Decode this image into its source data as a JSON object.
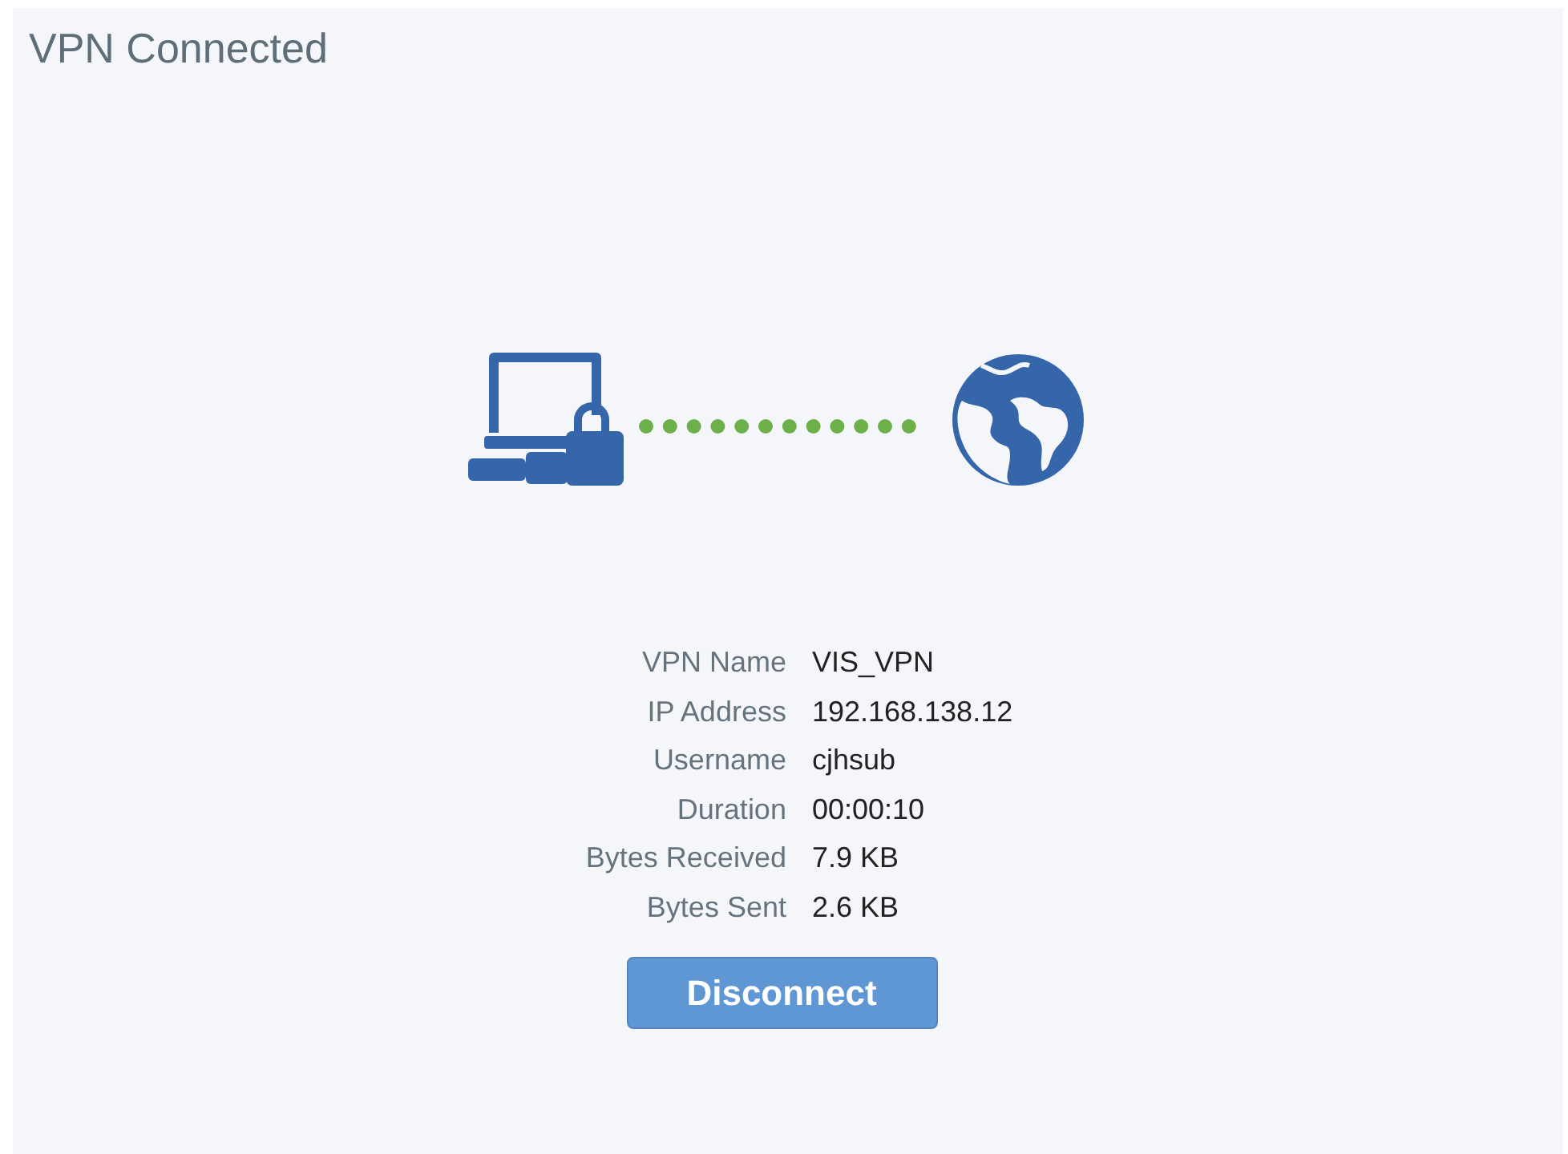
{
  "title": "VPN Connected",
  "details": [
    {
      "label": "VPN Name",
      "value": "VIS_VPN"
    },
    {
      "label": "IP Address",
      "value": "192.168.138.12"
    },
    {
      "label": "Username",
      "value": "cjhsub"
    },
    {
      "label": "Duration",
      "value": "00:00:10"
    },
    {
      "label": "Bytes Received",
      "value": "7.9 KB"
    },
    {
      "label": "Bytes Sent",
      "value": "2.6 KB"
    }
  ],
  "button": "Disconnect"
}
